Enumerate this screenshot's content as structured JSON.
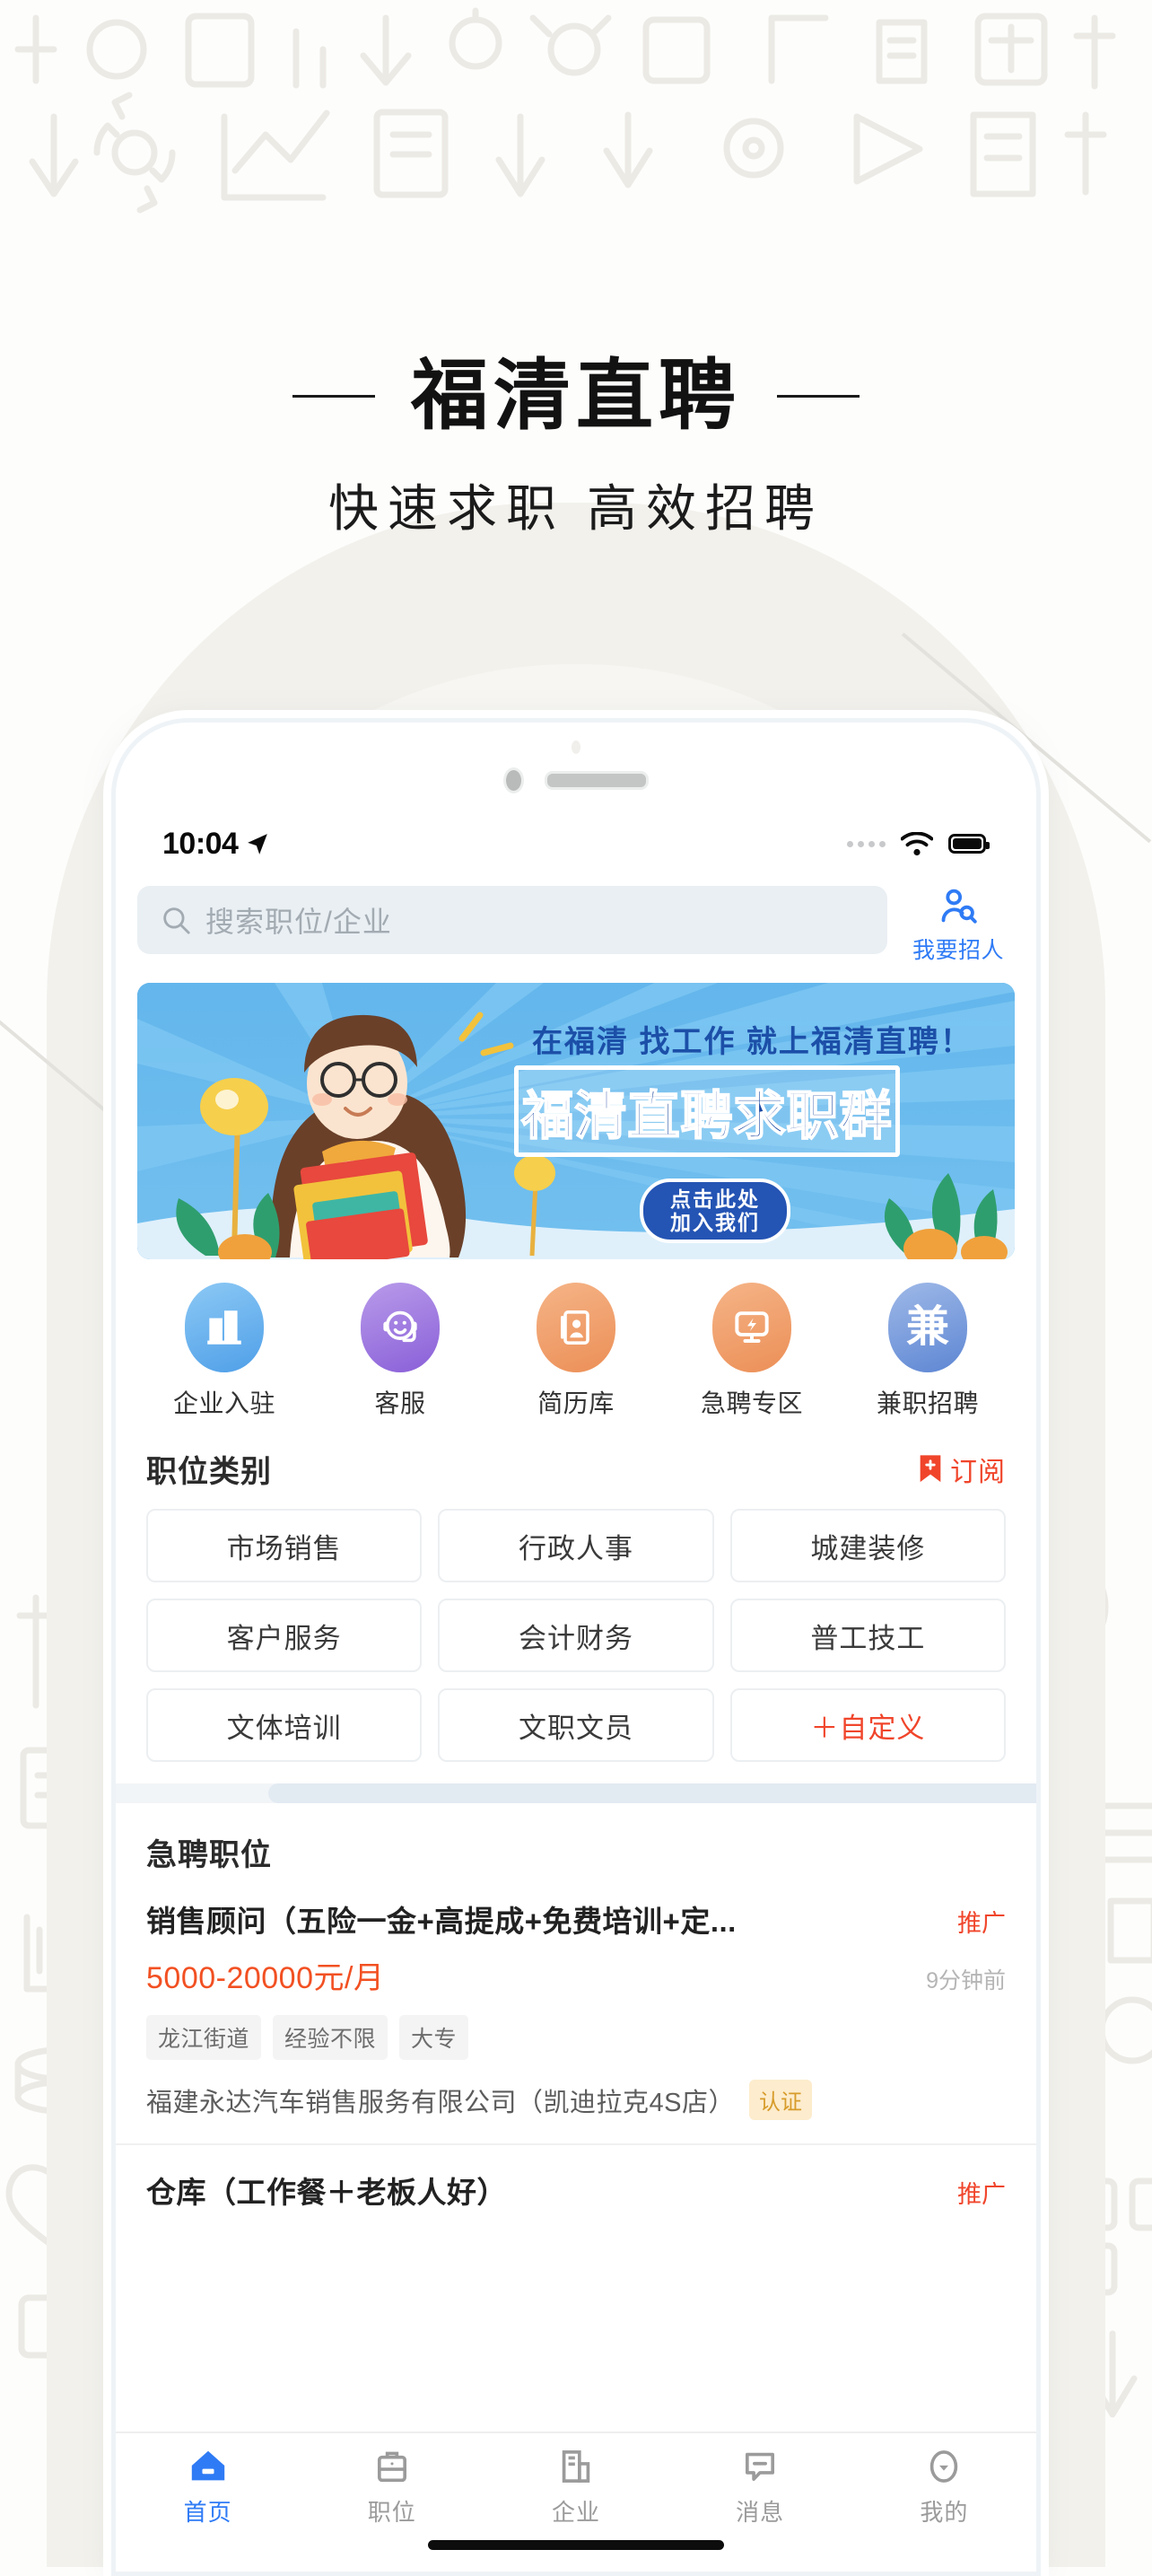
{
  "promo": {
    "title": "福清直聘",
    "subtitle": "快速求职 高效招聘"
  },
  "statusbar": {
    "time": "10:04",
    "location_icon": "location-arrow-icon",
    "signal_icon": "signal-dots-icon",
    "wifi_icon": "wifi-icon",
    "battery_icon": "battery-full-icon"
  },
  "search": {
    "placeholder": "搜索职位/企业",
    "icon": "search-icon",
    "recruit_label": "我要招人",
    "recruit_icon": "person-search-icon",
    "accent": "#2f7bf5"
  },
  "banner": {
    "headline": "在福清 找工作 就上福清直聘！",
    "main_text": "福清直聘求职群",
    "cta_line1": "点击此处",
    "cta_line2": "加入我们",
    "bg_color": "#5fb2e8",
    "text_color": "#1946a0"
  },
  "quick_actions": [
    {
      "label": "企业入驻",
      "icon": "building-icon",
      "color": "#5aa9f0"
    },
    {
      "label": "客服",
      "icon": "headset-face-icon",
      "color": "#9b6bdd"
    },
    {
      "label": "简历库",
      "icon": "resume-card-icon",
      "color": "#f0a171"
    },
    {
      "label": "急聘专区",
      "icon": "lightning-monitor-icon",
      "color": "#f0a171"
    },
    {
      "label": "兼职招聘",
      "icon": "jian-char-icon",
      "color": "#6d93dd"
    }
  ],
  "categories": {
    "title": "职位类别",
    "subscribe_label": "订阅",
    "subscribe_icon": "bookmark-plus-icon",
    "subscribe_color": "#f0452b",
    "items": [
      {
        "label": "市场销售",
        "accent": false
      },
      {
        "label": "行政人事",
        "accent": false
      },
      {
        "label": "城建装修",
        "accent": false
      },
      {
        "label": "客户服务",
        "accent": false
      },
      {
        "label": "会计财务",
        "accent": false
      },
      {
        "label": "普工技工",
        "accent": false
      },
      {
        "label": "文体培训",
        "accent": false
      },
      {
        "label": "文职文员",
        "accent": false
      },
      {
        "label": "＋自定义",
        "accent": true
      }
    ]
  },
  "urgent": {
    "title": "急聘职位",
    "jobs": [
      {
        "title": "销售顾问（五险一金+高提成+免费培训+定...",
        "promo": "推广",
        "salary": "5000-20000元/月",
        "time": "9分钟前",
        "tags": [
          "龙江街道",
          "经验不限",
          "大专"
        ],
        "company": "福建永达汽车销售服务有限公司（凯迪拉克4S店）",
        "verify": "认证"
      },
      {
        "title": "仓库（工作餐＋老板人好）",
        "promo": "推广"
      }
    ]
  },
  "tabbar": {
    "items": [
      {
        "label": "首页",
        "icon": "home-icon",
        "active": true
      },
      {
        "label": "职位",
        "icon": "briefcase-icon",
        "active": false
      },
      {
        "label": "企业",
        "icon": "company-icon",
        "active": false
      },
      {
        "label": "消息",
        "icon": "message-icon",
        "active": false
      },
      {
        "label": "我的",
        "icon": "profile-icon",
        "active": false
      }
    ],
    "active_color": "#2f7bf5",
    "inactive_color": "#9b9b9b"
  }
}
